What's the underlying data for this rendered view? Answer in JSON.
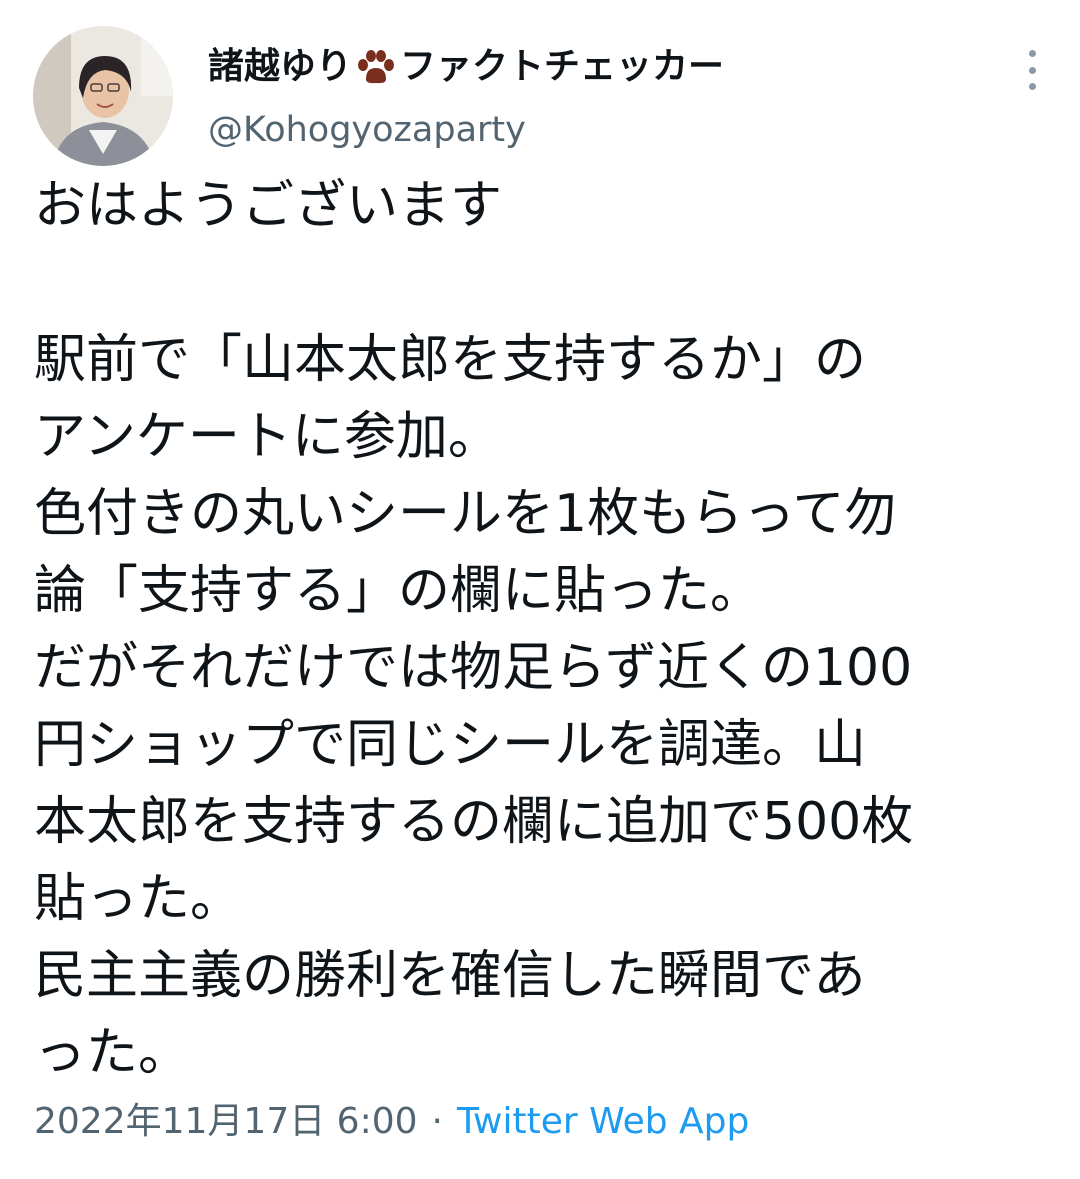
{
  "author": {
    "display_name_part1": "諸越ゆり",
    "display_name_part2": "ファクトチェッカー",
    "handle": "@Kohogyozaparty",
    "avatar_icon": "profile-photo",
    "badge_icon": "paw-icon",
    "badge_color": "#7a2e1e"
  },
  "menu": {
    "icon": "more-vertical-icon"
  },
  "tweet": {
    "lines": [
      "おはようございます",
      "",
      "駅前で「山本太郎を支持するか」の",
      "アンケートに参加。",
      "色付きの丸いシールを1枚もらって勿",
      "論「支持する」の欄に貼った。",
      "だがそれだけでは物足らず近くの100",
      "円ショップで同じシールを調達。山",
      "本太郎を支持するの欄に追加で500枚",
      "貼った。",
      "民主主義の勝利を確信した瞬間であ",
      "った。"
    ]
  },
  "meta": {
    "timestamp": "2022年11月17日 6:00",
    "separator": "·",
    "source": "Twitter Web App"
  },
  "colors": {
    "text": "#0f1419",
    "secondary": "#536471",
    "link": "#1d9bf0"
  }
}
